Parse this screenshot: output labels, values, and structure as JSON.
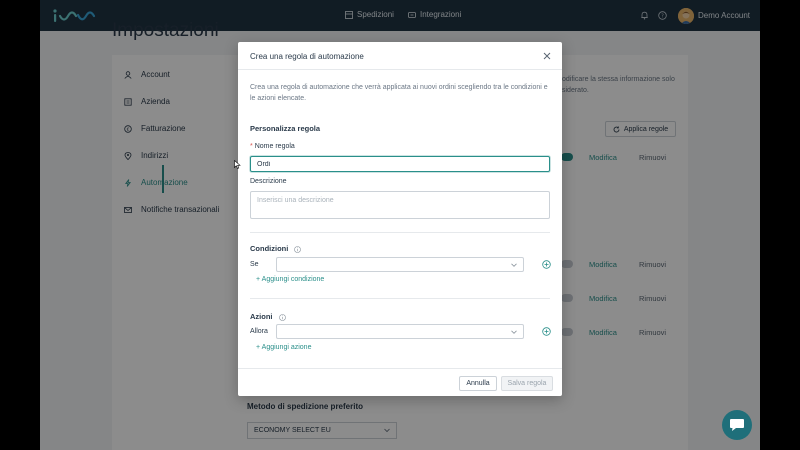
{
  "topbar": {
    "nav": [
      {
        "label": "Spedizioni",
        "icon": "box-icon"
      },
      {
        "label": "Integrazioni",
        "icon": "plug-icon"
      }
    ],
    "account_name": "Demo Account"
  },
  "page": {
    "title": "Impostazioni"
  },
  "sidebar": {
    "items": [
      {
        "label": "Account",
        "icon": "user-icon"
      },
      {
        "label": "Azienda",
        "icon": "building-icon"
      },
      {
        "label": "Fatturazione",
        "icon": "coin-icon"
      },
      {
        "label": "Indirizzi",
        "icon": "pin-icon"
      },
      {
        "label": "Automazione",
        "icon": "bolt-icon",
        "active": true
      },
      {
        "label": "Notifiche transazionali",
        "icon": "mail-icon"
      }
    ]
  },
  "background": {
    "hint_line1": "odificare la stessa informazione solo",
    "hint_line2": "siderato.",
    "apply_rules_label": "Applica regole",
    "rows": [
      {
        "edit": "Modifica",
        "remove": "Rimuovi"
      },
      {
        "edit": "Modifica",
        "remove": "Rimuovi"
      },
      {
        "edit": "Modifica",
        "remove": "Rimuovi"
      },
      {
        "edit": "Modifica",
        "remove": "Rimuovi"
      }
    ],
    "shipping_method_label": "Metodo di spedizione preferito",
    "shipping_method_value": "ECONOMY SELECT EU"
  },
  "modal": {
    "title": "Crea una regola di automazione",
    "description": "Crea una regola di automazione che verrà applicata ai nuovi ordini scegliendo tra le condizioni e le azioni elencate.",
    "customize_title": "Personalizza regola",
    "name_label": "Nome regola",
    "name_required_mark": "*",
    "name_value": "Ordi",
    "description_label": "Descrizione",
    "description_placeholder": "Inserisci una descrizione",
    "conditions_title": "Condizioni",
    "if_label": "Se",
    "add_condition": "+ Aggiungi condizione",
    "actions_title": "Azioni",
    "then_label": "Allora",
    "add_action": "+ Aggiungi azione",
    "cancel_label": "Annulla",
    "save_label": "Salva regola"
  },
  "colors": {
    "topbar": "#1f3343",
    "accent": "#2a8f8a",
    "chat": "#1f6f7a"
  }
}
